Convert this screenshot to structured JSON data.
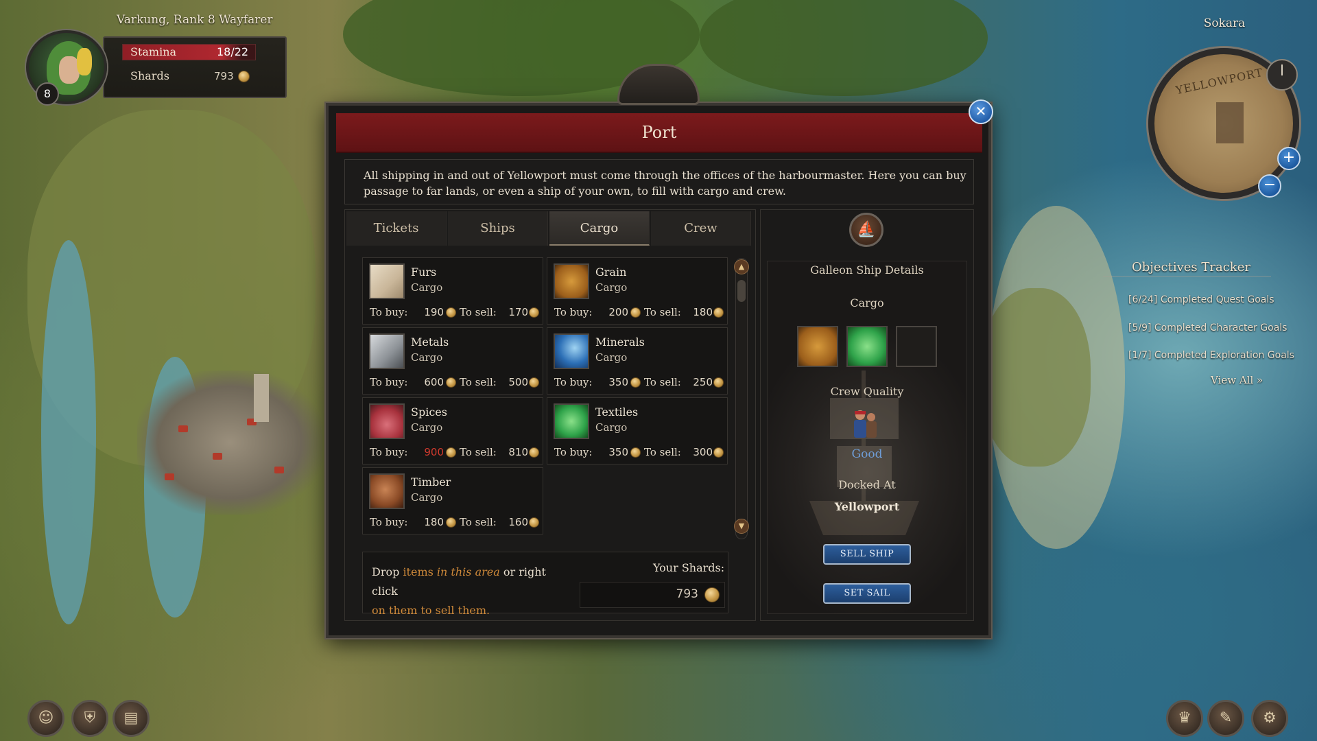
{
  "hud": {
    "player_title": "Varkung, Rank 8 Wayfarer",
    "level": "8",
    "stamina_label": "Stamina",
    "stamina_value": "18/22",
    "stamina_fraction": 0.818,
    "shards_label": "Shards",
    "shards_value": "793"
  },
  "minimap": {
    "region": "Sokara",
    "map_label": "YELLOWPORT",
    "zoom_in_icon": "plus-icon",
    "zoom_out_icon": "minus-icon"
  },
  "objectives": {
    "title": "Objectives Tracker",
    "items": [
      "[6/24] Completed Quest Goals",
      "[5/9] Completed Character Goals",
      "[1/7] Completed Exploration Goals"
    ],
    "view_all": "View All »"
  },
  "dialog": {
    "title": "Port",
    "close_icon": "close-icon",
    "intro": "All shipping in and out of Yellowport must come through the offices of the harbourmaster. Here you can buy passage to far lands, or even a ship of your own, to fill with cargo and crew.",
    "tabs": [
      {
        "label": "Tickets",
        "active": false
      },
      {
        "label": "Ships",
        "active": false
      },
      {
        "label": "Cargo",
        "active": true
      },
      {
        "label": "Crew",
        "active": false
      }
    ],
    "buy_label": "To buy:",
    "sell_label": "To sell:",
    "items": [
      {
        "name": "Furs",
        "type": "Cargo",
        "buy": "190",
        "sell": "170",
        "icon": "furs-icon"
      },
      {
        "name": "Grain",
        "type": "Cargo",
        "buy": "200",
        "sell": "180",
        "icon": "grain-icon"
      },
      {
        "name": "Metals",
        "type": "Cargo",
        "buy": "600",
        "sell": "500",
        "icon": "metals-icon"
      },
      {
        "name": "Minerals",
        "type": "Cargo",
        "buy": "350",
        "sell": "250",
        "icon": "minerals-icon"
      },
      {
        "name": "Spices",
        "type": "Cargo",
        "buy": "900",
        "sell": "810",
        "icon": "spices-icon",
        "buy_unaffordable": true
      },
      {
        "name": "Textiles",
        "type": "Cargo",
        "buy": "350",
        "sell": "300",
        "icon": "textiles-icon"
      },
      {
        "name": "Timber",
        "type": "Cargo",
        "buy": "180",
        "sell": "160",
        "icon": "timber-icon"
      }
    ],
    "drop": {
      "part1": "Drop ",
      "part2": "items ",
      "part3": "in this area",
      "part4": " or ",
      "part5": "right click",
      "part6": "on them to sell them."
    },
    "your_shards_label": "Your Shards:",
    "your_shards_value": "793"
  },
  "ship": {
    "heading": "Galleon Ship Details",
    "cargo_heading": "Cargo",
    "cargo_slots": [
      "grain-icon",
      "textiles-icon",
      "empty-slot"
    ],
    "crew_heading": "Crew Quality",
    "crew_quality": "Good",
    "docked_heading": "Docked At",
    "docked_value": "Yellowport",
    "sell_button": "SELL SHIP",
    "sail_button": "SET SAIL"
  },
  "colors": {
    "header_red": "#7c1a1c",
    "accent_orange": "#d08a3a",
    "unaffordable_red": "#d23a2e",
    "crew_blue": "#6f9ed8",
    "button_blue": "#2d5e9c"
  },
  "dock_icons": [
    "character-icon",
    "helmet-icon",
    "journal-icon",
    "crown-icon",
    "map-scroll-icon",
    "settings-gear-icon"
  ]
}
